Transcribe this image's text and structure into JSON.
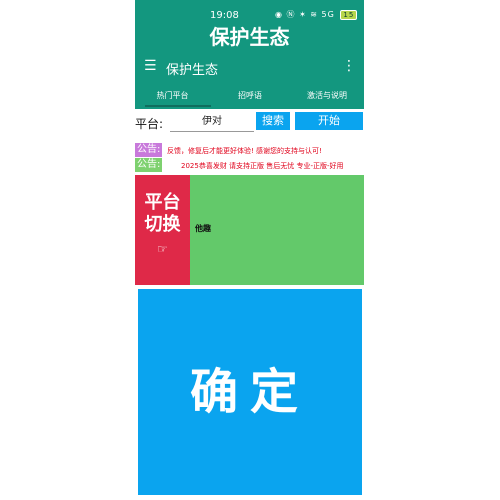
{
  "status_bar": {
    "time": "19:08",
    "icons": "◉ Ⓝ ✶ ≋ 5G",
    "battery": "15"
  },
  "app": {
    "big_title": "保护生态",
    "toolbar_title": "保护生态",
    "menu_icon": "hamburger-icon",
    "more_icon": "more-vert-icon"
  },
  "tabs": [
    {
      "label": "热门平台"
    },
    {
      "label": "招呼语"
    },
    {
      "label": "激活与说明"
    }
  ],
  "search": {
    "platform_label": "平台:",
    "input_value": "伊对",
    "search_label": "搜索",
    "start_label": "开始"
  },
  "notices": [
    {
      "tag": "公告:",
      "text": "反馈，修复后才能更好体验!      感谢您的支持与认可!"
    },
    {
      "tag": "公告:",
      "text": "2025恭喜发财 请支持正版 售后无忧 专业-正版-好用"
    }
  ],
  "platform_switch": {
    "line1": "平台",
    "line2": "切换",
    "hand": "☞",
    "current_platform": "他趣"
  },
  "confirm_label": "确定",
  "colors": {
    "primary": "#13977f",
    "button": "#0aa4ef",
    "switch": "#df2948",
    "platform_bg": "#63c96a",
    "notice_text": "#e0001a"
  }
}
